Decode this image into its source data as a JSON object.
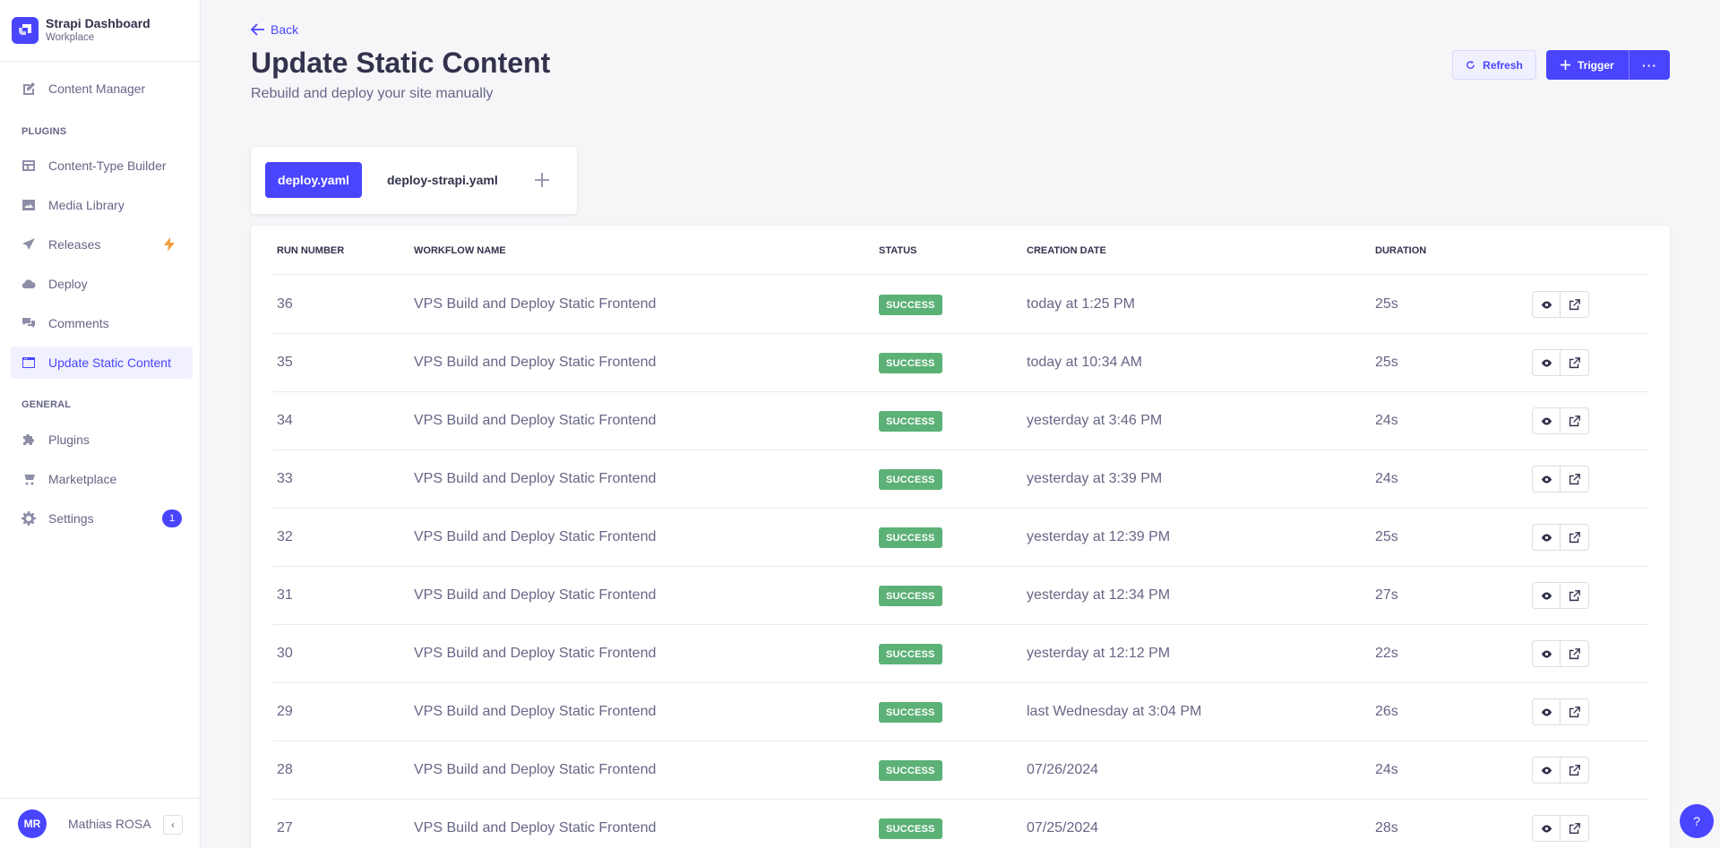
{
  "brand": {
    "title": "Strapi Dashboard",
    "subtitle": "Workplace"
  },
  "sidebar": {
    "items": [
      {
        "label": "Content Manager",
        "icon": "content-manager-icon"
      },
      {
        "label": "Content-Type Builder",
        "icon": "layout-icon"
      },
      {
        "label": "Media Library",
        "icon": "image-icon"
      },
      {
        "label": "Releases",
        "icon": "paper-plane-icon"
      },
      {
        "label": "Deploy",
        "icon": "cloud-icon"
      },
      {
        "label": "Comments",
        "icon": "chat-bubbles-icon"
      },
      {
        "label": "Update Static Content",
        "icon": "browser-window-icon"
      },
      {
        "label": "Plugins",
        "icon": "puzzle-icon"
      },
      {
        "label": "Marketplace",
        "icon": "cart-icon"
      },
      {
        "label": "Settings",
        "icon": "gear-icon"
      }
    ],
    "sections": {
      "plugins": "PLUGINS",
      "general": "GENERAL"
    },
    "settings_badge": "1",
    "accent_bolt_color": "#f29d41"
  },
  "user": {
    "initials": "MR",
    "name": "Mathias ROSA"
  },
  "header": {
    "back_label": "Back",
    "title": "Update Static Content",
    "subtitle": "Rebuild and deploy your site manually",
    "refresh_label": "Refresh",
    "trigger_label": "Trigger",
    "more_label": "···"
  },
  "tabs": [
    "deploy.yaml",
    "deploy-strapi.yaml"
  ],
  "table": {
    "headers": [
      "RUN NUMBER",
      "WORKFLOW NAME",
      "STATUS",
      "CREATION DATE",
      "DURATION"
    ],
    "rows": [
      {
        "run": "36",
        "workflow": "VPS Build and Deploy Static Frontend",
        "status": "SUCCESS",
        "date": "today at 1:25 PM",
        "duration": "25s"
      },
      {
        "run": "35",
        "workflow": "VPS Build and Deploy Static Frontend",
        "status": "SUCCESS",
        "date": "today at 10:34 AM",
        "duration": "25s"
      },
      {
        "run": "34",
        "workflow": "VPS Build and Deploy Static Frontend",
        "status": "SUCCESS",
        "date": "yesterday at 3:46 PM",
        "duration": "24s"
      },
      {
        "run": "33",
        "workflow": "VPS Build and Deploy Static Frontend",
        "status": "SUCCESS",
        "date": "yesterday at 3:39 PM",
        "duration": "24s"
      },
      {
        "run": "32",
        "workflow": "VPS Build and Deploy Static Frontend",
        "status": "SUCCESS",
        "date": "yesterday at 12:39 PM",
        "duration": "25s"
      },
      {
        "run": "31",
        "workflow": "VPS Build and Deploy Static Frontend",
        "status": "SUCCESS",
        "date": "yesterday at 12:34 PM",
        "duration": "27s"
      },
      {
        "run": "30",
        "workflow": "VPS Build and Deploy Static Frontend",
        "status": "SUCCESS",
        "date": "yesterday at 12:12 PM",
        "duration": "22s"
      },
      {
        "run": "29",
        "workflow": "VPS Build and Deploy Static Frontend",
        "status": "SUCCESS",
        "date": "last Wednesday at 3:04 PM",
        "duration": "26s"
      },
      {
        "run": "28",
        "workflow": "VPS Build and Deploy Static Frontend",
        "status": "SUCCESS",
        "date": "07/26/2024",
        "duration": "24s"
      },
      {
        "run": "27",
        "workflow": "VPS Build and Deploy Static Frontend",
        "status": "SUCCESS",
        "date": "07/25/2024",
        "duration": "28s"
      }
    ]
  },
  "help_label": "?",
  "colors": {
    "accent": "#4945ff",
    "success": "#5cb176",
    "background": "#f6f6f9"
  }
}
